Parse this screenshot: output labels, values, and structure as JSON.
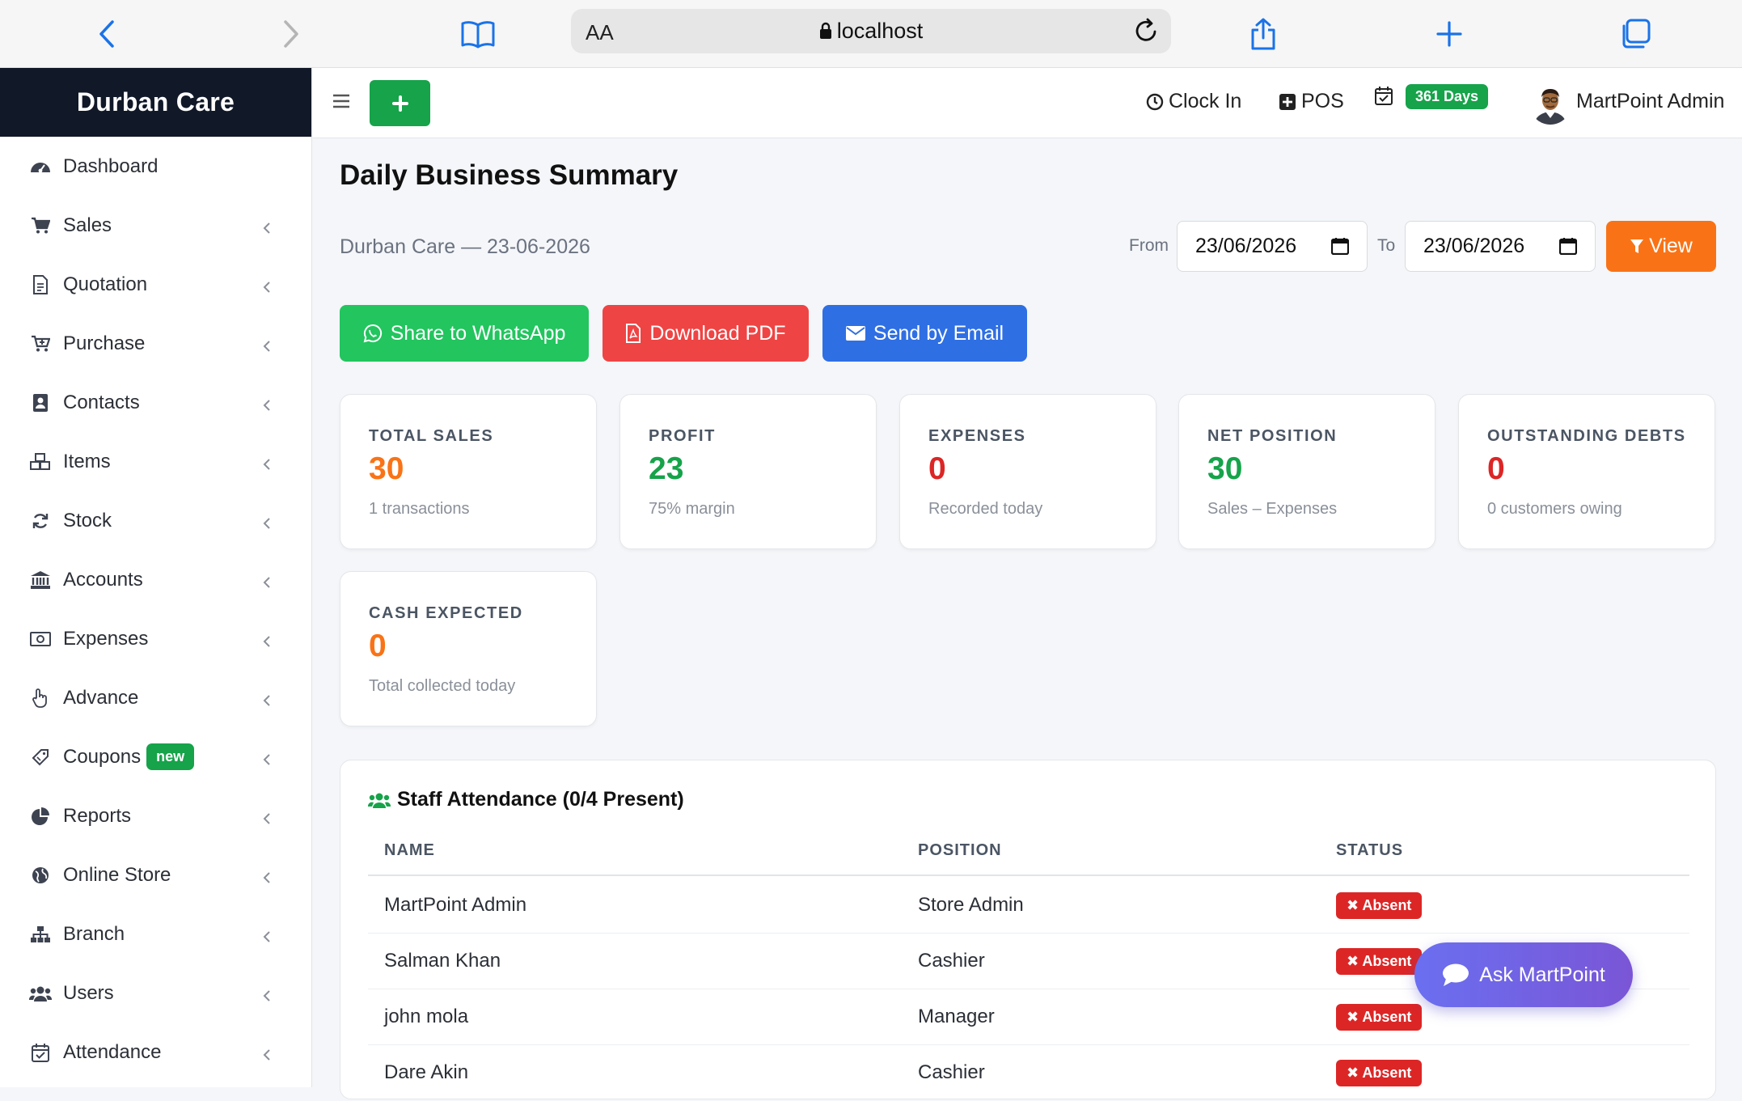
{
  "browser": {
    "text_size_label": "AA",
    "url": "localhost"
  },
  "app": {
    "brand": "Durban Care"
  },
  "sidebar": {
    "items": [
      {
        "label": "Dashboard",
        "icon": "dashboard-icon"
      },
      {
        "label": "Sales",
        "icon": "cart-icon"
      },
      {
        "label": "Quotation",
        "icon": "document-icon"
      },
      {
        "label": "Purchase",
        "icon": "cart-plus-icon"
      },
      {
        "label": "Contacts",
        "icon": "address-book-icon"
      },
      {
        "label": "Items",
        "icon": "cubes-icon"
      },
      {
        "label": "Stock",
        "icon": "refresh-icon"
      },
      {
        "label": "Accounts",
        "icon": "bank-icon"
      },
      {
        "label": "Expenses",
        "icon": "money-icon"
      },
      {
        "label": "Advance",
        "icon": "hand-icon"
      },
      {
        "label": "Coupons",
        "icon": "ticket-icon",
        "badge": "new"
      },
      {
        "label": "Reports",
        "icon": "pie-chart-icon"
      },
      {
        "label": "Online Store",
        "icon": "globe-icon"
      },
      {
        "label": "Branch",
        "icon": "sitemap-icon"
      },
      {
        "label": "Users",
        "icon": "users-icon"
      },
      {
        "label": "Attendance",
        "icon": "calendar-check-icon"
      }
    ]
  },
  "topbar": {
    "clock_in": "Clock In",
    "pos": "POS",
    "days_badge": "361 Days",
    "user_name": "MartPoint Admin"
  },
  "page": {
    "title": "Daily Business Summary",
    "subtitle": "Durban Care — 23-06-2026",
    "from_label": "From",
    "from_value": "23/06/2026",
    "to_label": "To",
    "to_value": "23/06/2026",
    "view_label": "View"
  },
  "actions": {
    "whatsapp": "Share to WhatsApp",
    "pdf": "Download PDF",
    "email": "Send by Email"
  },
  "cards": [
    {
      "title": "TOTAL SALES",
      "value": "30",
      "sub": "1 transactions",
      "color": "#f97316"
    },
    {
      "title": "PROFIT",
      "value": "23",
      "sub": "75% margin",
      "color": "#16a34a"
    },
    {
      "title": "EXPENSES",
      "value": "0",
      "sub": "Recorded today",
      "color": "#dc2626"
    },
    {
      "title": "NET POSITION",
      "value": "30",
      "sub": "Sales – Expenses",
      "color": "#16a34a"
    },
    {
      "title": "OUTSTANDING DEBTS",
      "value": "0",
      "sub": "0 customers owing",
      "color": "#dc2626"
    },
    {
      "title": "CASH EXPECTED",
      "value": "0",
      "sub": "Total collected today",
      "color": "#f97316"
    }
  ],
  "attendance": {
    "title": "Staff Attendance (0/4 Present)",
    "columns": [
      "NAME",
      "POSITION",
      "STATUS"
    ],
    "rows": [
      {
        "name": "MartPoint Admin",
        "position": "Store Admin",
        "status": "Absent"
      },
      {
        "name": "Salman Khan",
        "position": "Cashier",
        "status": "Absent"
      },
      {
        "name": "john mola",
        "position": "Manager",
        "status": "Absent"
      },
      {
        "name": "Dare Akin",
        "position": "Cashier",
        "status": "Absent"
      }
    ]
  },
  "assistant": {
    "label": "Ask MartPoint"
  },
  "colors": {
    "brand_dark": "#111827",
    "success": "#16a34a",
    "danger": "#dc2626",
    "warning": "#f97316",
    "primary": "#2f6fe4",
    "whatsapp": "#22c55e"
  }
}
